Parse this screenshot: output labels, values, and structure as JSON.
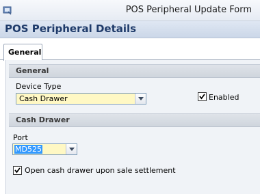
{
  "window": {
    "title": "POS Peripheral Update Form"
  },
  "header": {
    "title": "POS Peripheral Details"
  },
  "tabs": [
    {
      "label": "General",
      "active": true
    }
  ],
  "sections": {
    "general": {
      "title": "General",
      "device_type_label": "Device Type",
      "device_type_value": "Cash Drawer",
      "enabled_label": "Enabled",
      "enabled_checked": true
    },
    "cash_drawer": {
      "title": "Cash Drawer",
      "port_label": "Port",
      "port_value": "MD525",
      "open_drawer_label": "Open cash drawer upon sale settlement",
      "open_drawer_checked": true
    }
  },
  "colors": {
    "header_text": "#1f3b6a",
    "combo_background": "#fff8c4",
    "selection": "#3399ff"
  },
  "icons": {
    "app": "app-window-icon",
    "dropdown": "chevron-down-icon",
    "check": "checkmark-icon"
  }
}
